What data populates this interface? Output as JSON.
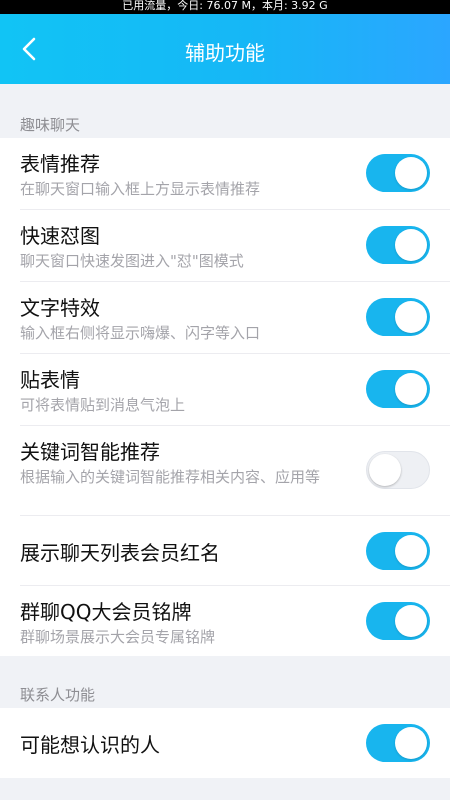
{
  "status_bar": {
    "text": "已用流量，今日: 76.07 M，本月: 3.92 G"
  },
  "header": {
    "title": "辅助功能",
    "back_icon": "chevron-left-icon"
  },
  "sections": [
    {
      "title": "趣味聊天",
      "items": [
        {
          "title": "表情推荐",
          "desc": "在聊天窗口输入框上方显示表情推荐",
          "on": true
        },
        {
          "title": "快速怼图",
          "desc": "聊天窗口快速发图进入\"怼\"图模式",
          "on": true
        },
        {
          "title": "文字特效",
          "desc": "输入框右侧将显示嗨爆、闪字等入口",
          "on": true
        },
        {
          "title": "贴表情",
          "desc": "可将表情贴到消息气泡上",
          "on": true
        },
        {
          "title": "关键词智能推荐",
          "desc": "根据输入的关键词智能推荐相关内容、应用等",
          "on": false
        },
        {
          "title": "展示聊天列表会员红名",
          "desc": "",
          "on": true
        },
        {
          "title": "群聊QQ大会员铭牌",
          "desc": "群聊场景展示大会员专属铭牌",
          "on": true
        }
      ]
    },
    {
      "title": "联系人功能",
      "items": [
        {
          "title": "可能想认识的人",
          "desc": "",
          "on": true
        }
      ]
    }
  ],
  "colors": {
    "accent": "#18b5ee",
    "header_start": "#11c4f5",
    "header_end": "#2ba6ff"
  }
}
